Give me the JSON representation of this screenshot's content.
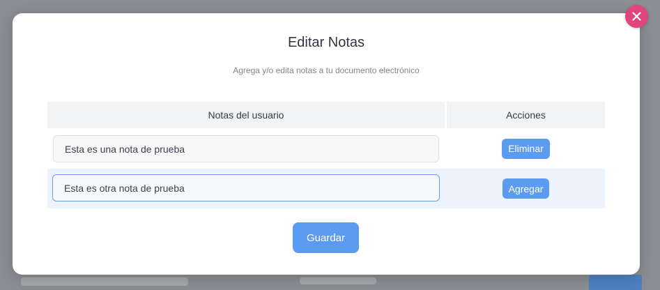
{
  "modal": {
    "title": "Editar Notas",
    "subtitle": "Agrega y/o edita notas a tu documento electrónico",
    "close_icon": "close-icon",
    "table": {
      "columns": [
        "Notas del usuario",
        "Acciones"
      ],
      "rows": [
        {
          "note": "Esta es una nota de prueba",
          "action": "Eliminar"
        },
        {
          "note": "Esta es otra nota de prueba",
          "action": "Agregar"
        }
      ]
    },
    "save_label": "Guardar"
  },
  "colors": {
    "accent": "#5b9bf0",
    "close": "#e0457b",
    "row_highlight": "#edf3fd"
  }
}
